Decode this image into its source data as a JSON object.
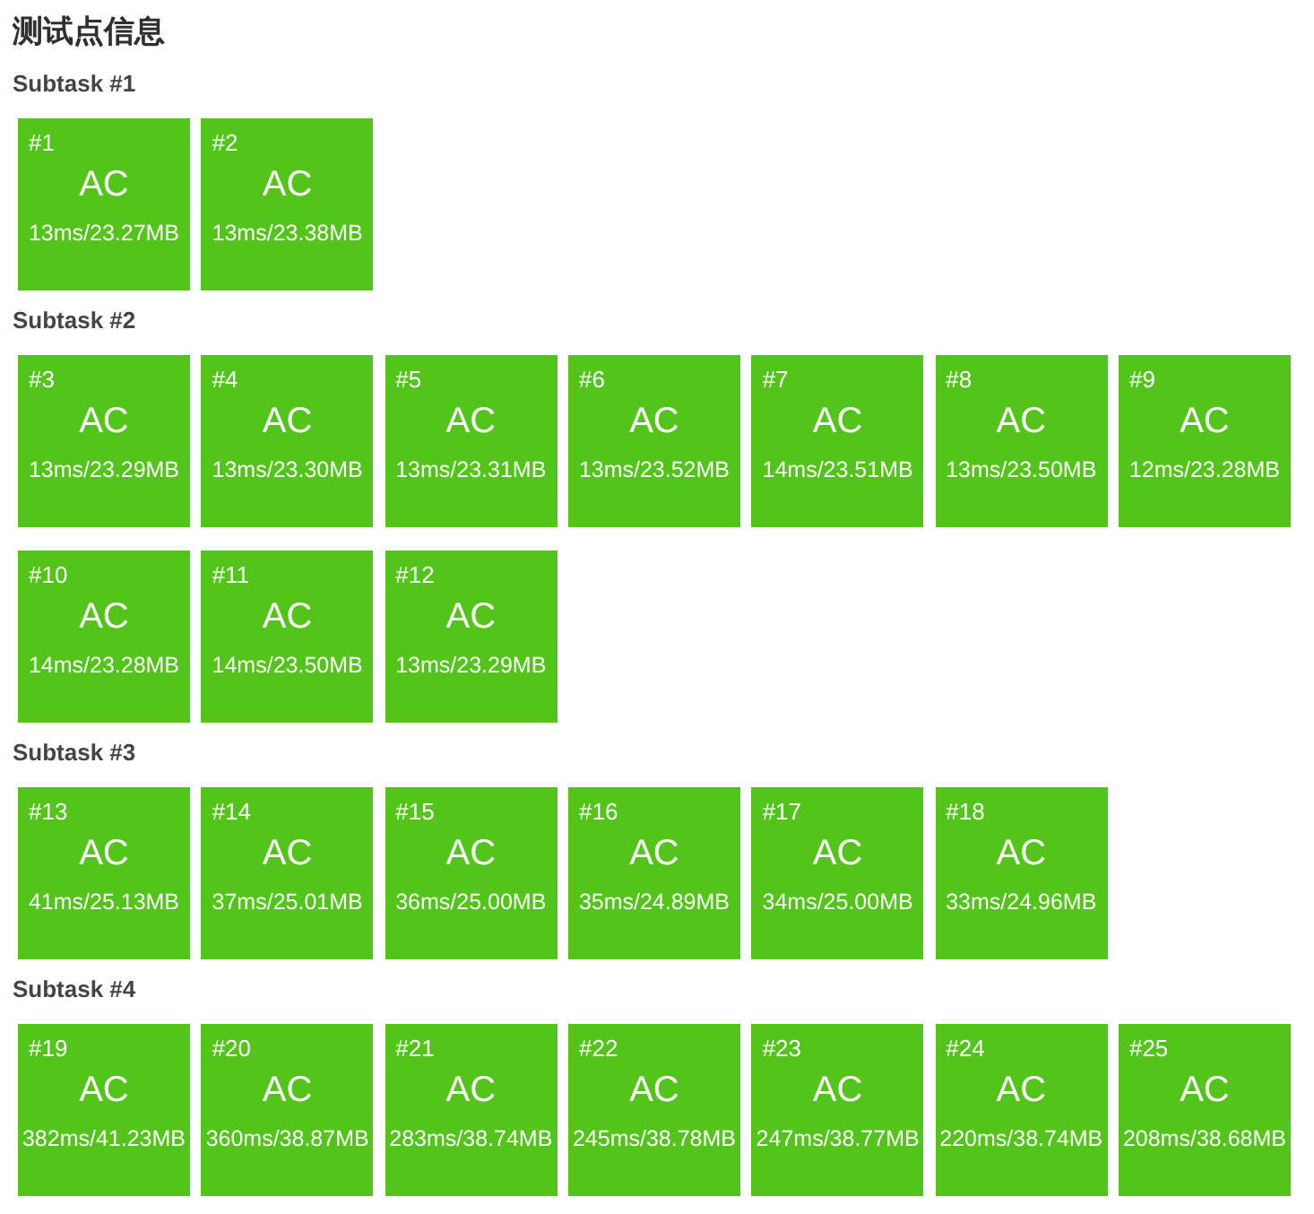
{
  "title": "测试点信息",
  "subtasks": [
    {
      "label": "Subtask #1",
      "cases": [
        {
          "id": "#1",
          "status": "AC",
          "stats": "13ms/23.27MB"
        },
        {
          "id": "#2",
          "status": "AC",
          "stats": "13ms/23.38MB"
        }
      ]
    },
    {
      "label": "Subtask #2",
      "cases": [
        {
          "id": "#3",
          "status": "AC",
          "stats": "13ms/23.29MB"
        },
        {
          "id": "#4",
          "status": "AC",
          "stats": "13ms/23.30MB"
        },
        {
          "id": "#5",
          "status": "AC",
          "stats": "13ms/23.31MB"
        },
        {
          "id": "#6",
          "status": "AC",
          "stats": "13ms/23.52MB"
        },
        {
          "id": "#7",
          "status": "AC",
          "stats": "14ms/23.51MB"
        },
        {
          "id": "#8",
          "status": "AC",
          "stats": "13ms/23.50MB"
        },
        {
          "id": "#9",
          "status": "AC",
          "stats": "12ms/23.28MB"
        },
        {
          "id": "#10",
          "status": "AC",
          "stats": "14ms/23.28MB"
        },
        {
          "id": "#11",
          "status": "AC",
          "stats": "14ms/23.50MB"
        },
        {
          "id": "#12",
          "status": "AC",
          "stats": "13ms/23.29MB"
        }
      ]
    },
    {
      "label": "Subtask #3",
      "cases": [
        {
          "id": "#13",
          "status": "AC",
          "stats": "41ms/25.13MB"
        },
        {
          "id": "#14",
          "status": "AC",
          "stats": "37ms/25.01MB"
        },
        {
          "id": "#15",
          "status": "AC",
          "stats": "36ms/25.00MB"
        },
        {
          "id": "#16",
          "status": "AC",
          "stats": "35ms/24.89MB"
        },
        {
          "id": "#17",
          "status": "AC",
          "stats": "34ms/25.00MB"
        },
        {
          "id": "#18",
          "status": "AC",
          "stats": "33ms/24.96MB"
        }
      ]
    },
    {
      "label": "Subtask #4",
      "cases": [
        {
          "id": "#19",
          "status": "AC",
          "stats": "382ms/41.23MB"
        },
        {
          "id": "#20",
          "status": "AC",
          "stats": "360ms/38.87MB"
        },
        {
          "id": "#21",
          "status": "AC",
          "stats": "283ms/38.74MB"
        },
        {
          "id": "#22",
          "status": "AC",
          "stats": "245ms/38.78MB"
        },
        {
          "id": "#23",
          "status": "AC",
          "stats": "247ms/38.77MB"
        },
        {
          "id": "#24",
          "status": "AC",
          "stats": "220ms/38.74MB"
        },
        {
          "id": "#25",
          "status": "AC",
          "stats": "208ms/38.68MB"
        }
      ]
    }
  ]
}
